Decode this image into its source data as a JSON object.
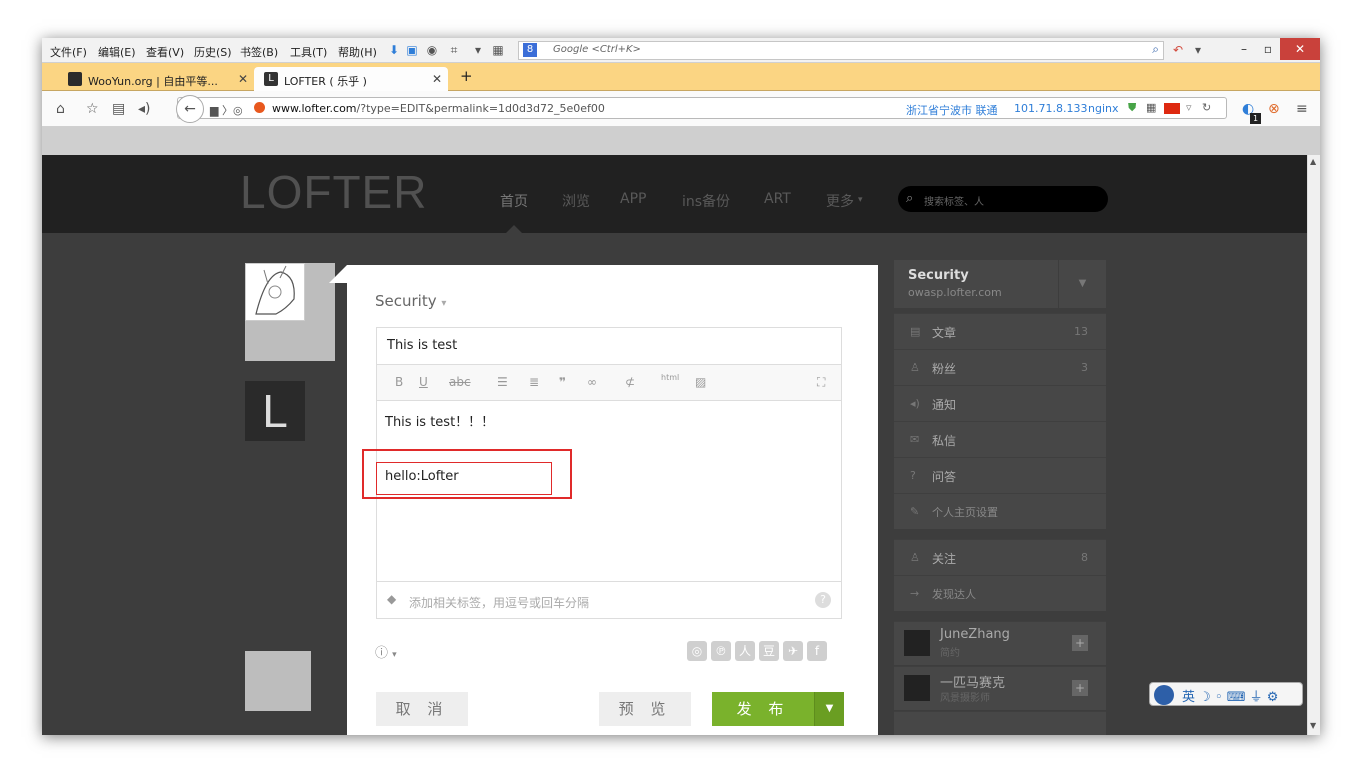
{
  "menubar": {
    "items": [
      "文件(F)",
      "编辑(E)",
      "查看(V)",
      "历史(S)",
      "书签(B)",
      "工具(T)",
      "帮助(H)"
    ],
    "search_placeholder": "Google <Ctrl+K>"
  },
  "tabs": [
    {
      "title": "WooYun.org | 自由平等...",
      "active": false
    },
    {
      "title": "LOFTER ( 乐乎 )",
      "active": true
    }
  ],
  "navbar": {
    "url": "www.lofter.com/?type=EDIT&permalink=1d0d3d72_5e0ef00",
    "url_domain": "www.lofter.com",
    "url_path": "/?type=EDIT&permalink=1d0d3d72_5e0ef00",
    "location": "浙江省宁波市 联通",
    "ip": "101.71.8.133",
    "server": "nginx",
    "badge_count": "1"
  },
  "site": {
    "logo": "LOFTER",
    "nav": [
      "首页",
      "浏览",
      "APP",
      "ins备份",
      "ART",
      "更多"
    ],
    "search_placeholder": "搜索标签、人"
  },
  "editor": {
    "blog_name": "Security",
    "title_value": "This is test",
    "toolbar": [
      "B",
      "U",
      "abc",
      "bullet-list",
      "numbered-list",
      "quote",
      "link",
      "unlink",
      "html",
      "image",
      "fullscreen"
    ],
    "body_line1": "This is test！！！",
    "body_line2": "hello:Lofter",
    "tag_placeholder": "添加相关标签，用逗号或回车分隔",
    "cancel_label": "取 消",
    "preview_label": "预 览",
    "publish_label": "发 布",
    "publish_color": "#7ab22c"
  },
  "sidebar": {
    "blog_title": "Security",
    "blog_url": "owasp.lofter.com",
    "items": [
      {
        "label": "文章",
        "count": "13"
      },
      {
        "label": "粉丝",
        "count": "3"
      },
      {
        "label": "通知",
        "count": ""
      },
      {
        "label": "私信",
        "count": ""
      },
      {
        "label": "问答",
        "count": ""
      },
      {
        "label": "个人主页设置",
        "count": ""
      },
      {
        "label": "关注",
        "count": "8"
      },
      {
        "label": "发现达人",
        "count": ""
      }
    ],
    "users": [
      {
        "name": "JuneZhang",
        "sub": "简约"
      },
      {
        "name": "一匹马赛克",
        "sub": "风景摄影师"
      }
    ]
  },
  "ime": {
    "label": "英"
  }
}
